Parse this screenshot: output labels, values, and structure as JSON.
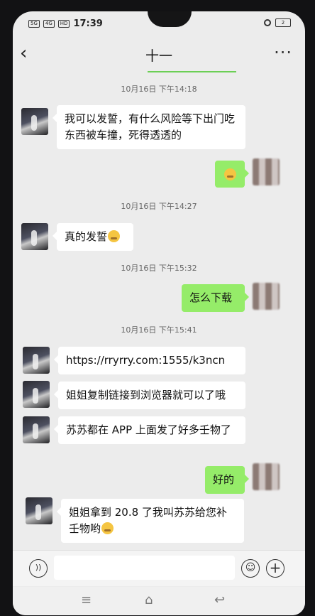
{
  "status": {
    "tags": [
      "5G",
      "4G",
      "HD"
    ],
    "time": "17:39",
    "battery": "2"
  },
  "header": {
    "title": "十一",
    "back": "‹",
    "more": "···"
  },
  "timestamps": [
    "10月16日 下午14:18",
    "10月16日 下午14:27",
    "10月16日 下午15:32",
    "10月16日 下午15:41"
  ],
  "messages": [
    {
      "side": "in",
      "text": "我可以发誓，有什么风险等下出门吃东西被车撞，死得透透的"
    },
    {
      "side": "out",
      "text": "",
      "emoji": "angry-emoji"
    },
    {
      "side": "in",
      "text": "真的发誓",
      "emoji": "sad-emoji"
    },
    {
      "side": "out",
      "text": "怎么下载"
    },
    {
      "side": "in",
      "text": "https://rryrry.com:1555/k3ncn"
    },
    {
      "side": "in",
      "text": "姐姐复制链接到浏览器就可以了哦"
    },
    {
      "side": "in",
      "text": "苏苏都在 APP 上面发了好多壬物了"
    },
    {
      "side": "out",
      "text": "好的"
    },
    {
      "side": "in",
      "text": "姐姐拿到 20.8 了我叫苏苏给您补壬物哟",
      "emoji": "sly-emoji"
    }
  ],
  "icons": {
    "voice": "voice-icon",
    "emoji": "emoji-icon",
    "plus": "plus-icon"
  },
  "nav": {
    "menu": "≡",
    "home": "⌂",
    "back": "↩"
  },
  "colors": {
    "out_bubble": "#95ec69",
    "in_bubble": "#ffffff",
    "background": "#ececec"
  }
}
